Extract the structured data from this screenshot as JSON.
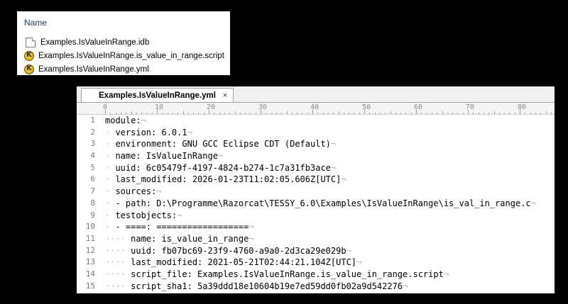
{
  "explorer": {
    "column_header": "Name",
    "files": [
      {
        "name": "Examples.IsValueInRange.idb",
        "icon": "document-icon"
      },
      {
        "name": "Examples.IsValueInRange.is_value_in_range.script",
        "icon": "tessy-app-icon"
      },
      {
        "name": "Examples.IsValueInRange.yml",
        "icon": "tessy-app-icon"
      }
    ]
  },
  "editor": {
    "tab": {
      "title": "Examples.IsValueInRange.yml",
      "close": "×"
    },
    "ruler": [
      "0",
      "10",
      "20",
      "30",
      "40",
      "50",
      "60",
      "70",
      "80"
    ],
    "lines": [
      {
        "num": "1",
        "indent": "",
        "text": "module:"
      },
      {
        "num": "2",
        "indent": "·",
        "text": " version: 6.0.1"
      },
      {
        "num": "3",
        "indent": "·",
        "text": " environment: GNU GCC Eclipse CDT (Default)"
      },
      {
        "num": "4",
        "indent": "·",
        "text": " name: IsValueInRange"
      },
      {
        "num": "5",
        "indent": "·",
        "text": " uuid: 6c05479f-4197-4824-b274-1c7a31fb3ace"
      },
      {
        "num": "6",
        "indent": "·",
        "text": " last_modified: 2026-01-23T11:02:05.606Z[UTC]"
      },
      {
        "num": "7",
        "indent": "·",
        "text": " sources:"
      },
      {
        "num": "8",
        "indent": "·",
        "text": " - path: D:\\Programme\\Razorcat\\TESSY_6.0\\Examples\\IsValueInRange\\is_val_in_range.c"
      },
      {
        "num": "9",
        "indent": "·",
        "text": " testobjects:"
      },
      {
        "num": "10",
        "indent": "·",
        "text": " - ====: =================="
      },
      {
        "num": "11",
        "indent": "····",
        "text": " name: is_value_in_range"
      },
      {
        "num": "12",
        "indent": "····",
        "text": " uuid: fb07bc69-23f9-4760-a9a0-2d3ca29e029b"
      },
      {
        "num": "13",
        "indent": "····",
        "text": " last_modified: 2021-05-21T02:44:21.104Z[UTC]"
      },
      {
        "num": "14",
        "indent": "····",
        "text": " script_file: Examples.IsValueInRange.is_value_in_range.script"
      },
      {
        "num": "15",
        "indent": "····",
        "text": " script_sha1: 5a39ddd18e10604b19e7ed59dd0fb02a9d542276"
      }
    ]
  }
}
